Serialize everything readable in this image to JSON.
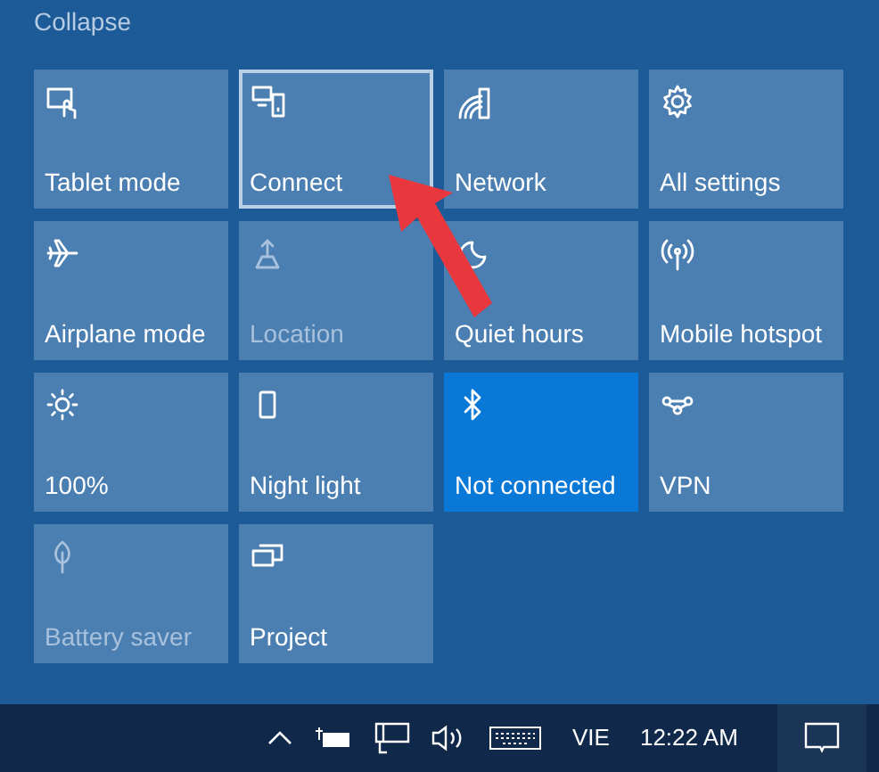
{
  "collapse_link": "Collapse",
  "tiles": [
    {
      "label": "Tablet mode",
      "on": false,
      "disabled": false,
      "focused": false
    },
    {
      "label": "Connect",
      "on": false,
      "disabled": false,
      "focused": true
    },
    {
      "label": "Network",
      "on": false,
      "disabled": false,
      "focused": false
    },
    {
      "label": "All settings",
      "on": false,
      "disabled": false,
      "focused": false
    },
    {
      "label": "Airplane mode",
      "on": false,
      "disabled": false,
      "focused": false
    },
    {
      "label": "Location",
      "on": false,
      "disabled": true,
      "focused": false
    },
    {
      "label": "Quiet hours",
      "on": false,
      "disabled": false,
      "focused": false
    },
    {
      "label": "Mobile hotspot",
      "on": false,
      "disabled": false,
      "focused": false
    },
    {
      "label": "100%",
      "on": false,
      "disabled": false,
      "focused": false
    },
    {
      "label": "Night light",
      "on": false,
      "disabled": false,
      "focused": false
    },
    {
      "label": "Not connected",
      "on": true,
      "disabled": false,
      "focused": false
    },
    {
      "label": "VPN",
      "on": false,
      "disabled": false,
      "focused": false
    },
    {
      "label": "Battery saver",
      "on": false,
      "disabled": true,
      "focused": false
    },
    {
      "label": "Project",
      "on": false,
      "disabled": false,
      "focused": false
    }
  ],
  "taskbar": {
    "language": "VIE",
    "clock": "12:22 AM"
  }
}
